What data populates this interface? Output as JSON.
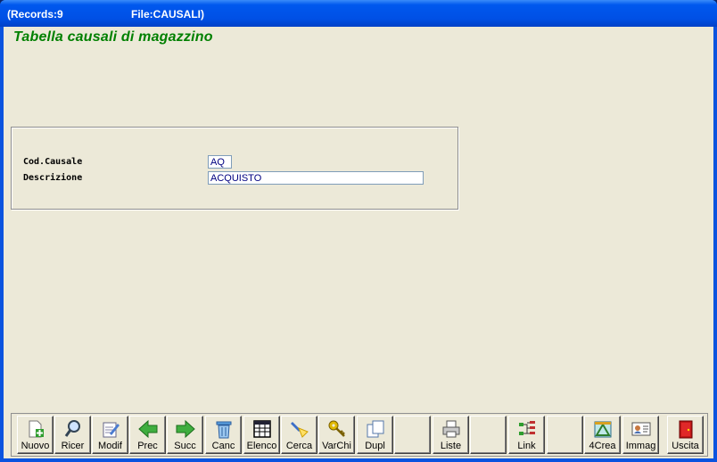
{
  "titlebar": {
    "records": "(Records:9",
    "file": "File:CAUSALI)"
  },
  "heading": "Tabella causali di magazzino",
  "form": {
    "cod_label": "Cod.Causale",
    "cod_value": "AQ",
    "desc_label": "Descrizione",
    "desc_value": "ACQUISTO"
  },
  "toolbar": {
    "nuovo": "Nuovo",
    "ricer": "Ricer",
    "modif": "Modif",
    "prec": "Prec",
    "succ": "Succ",
    "canc": "Canc",
    "elenco": "Elenco",
    "cerca": "Cerca",
    "varchi": "VarChi",
    "dupl": "Dupl",
    "liste": "Liste",
    "link": "Link",
    "crea": "4Crea",
    "immag": "Immag",
    "uscita": "Uscita"
  }
}
